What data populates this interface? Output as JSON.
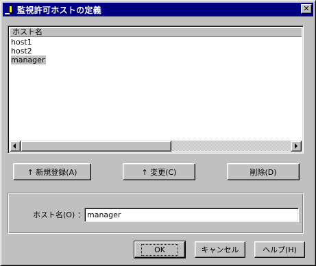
{
  "window": {
    "title": "監視許可ホストの定義",
    "close_glyph": "✕"
  },
  "list": {
    "column_header": "ホスト名",
    "rows": [
      "host1",
      "host2",
      "manager"
    ],
    "selected_index": 2
  },
  "actions": {
    "register_label": "↑ 新規登録(A)",
    "change_label": "↑ 変更(C)",
    "delete_label": "削除(D)"
  },
  "form": {
    "host_label": "ホスト名(O) ：",
    "host_value": "manager"
  },
  "footer": {
    "ok_label": "OK",
    "cancel_label": "キャンセル",
    "help_label": "ヘルプ(H)"
  },
  "colors": {
    "titlebar": "#000080",
    "face": "#c0c0c0",
    "selection": "#c0c0c0"
  }
}
